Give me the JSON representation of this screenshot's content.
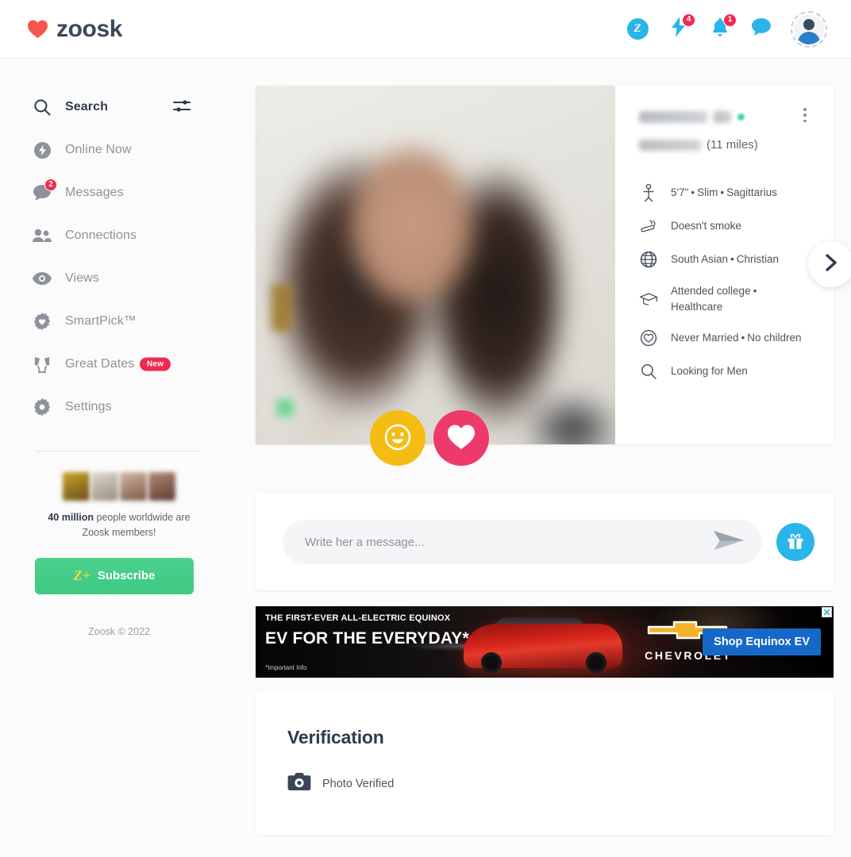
{
  "header": {
    "brand": "zoosk",
    "brand_icon": "heart-icon",
    "icons": {
      "zoosk_coins": "Z",
      "boost_icon": "lightning-bolt-icon",
      "boost_badge": "4",
      "bell_icon": "bell-icon",
      "bell_badge": "1",
      "chat_icon": "chat-bubble-icon",
      "avatar": "user-avatar-icon"
    }
  },
  "sidebar": {
    "items": [
      {
        "label": "Search",
        "icon": "search-icon",
        "active": true,
        "badge": null,
        "pill": null
      },
      {
        "label": "Online Now",
        "icon": "bolt-circle-icon",
        "active": false,
        "badge": null,
        "pill": null
      },
      {
        "label": "Messages",
        "icon": "chat-bubble-icon",
        "active": false,
        "badge": "2",
        "pill": null
      },
      {
        "label": "Connections",
        "icon": "people-icon",
        "active": false,
        "badge": null,
        "pill": null
      },
      {
        "label": "Views",
        "icon": "eye-icon",
        "active": false,
        "badge": null,
        "pill": null
      },
      {
        "label": "SmartPick™",
        "icon": "gear-heart-icon",
        "active": false,
        "badge": null,
        "pill": null
      },
      {
        "label": "Great Dates",
        "icon": "cheers-icon",
        "active": false,
        "badge": null,
        "pill": "New"
      },
      {
        "label": "Settings",
        "icon": "gear-icon",
        "active": false,
        "badge": null,
        "pill": null
      }
    ],
    "filter_icon": "sliders-filter-icon",
    "promo": {
      "bold": "40 million",
      "rest": " people worldwide are Zoosk members!",
      "subscribe_label": "Subscribe",
      "subscribe_icon": "z-plus-icon"
    },
    "copyright": "Zoosk © 2022"
  },
  "profile": {
    "name_redacted": true,
    "age_redacted": true,
    "online": true,
    "location_redacted": true,
    "distance": "(11 miles)",
    "menu_icon": "kebab-menu-icon",
    "next_icon": "chevron-right-icon",
    "actions": [
      {
        "name": "smile-button",
        "icon": "smiley-face-icon",
        "color": "#f5bc12"
      },
      {
        "name": "like-button",
        "icon": "heart-icon",
        "color": "#ee3a6b"
      }
    ],
    "details": [
      {
        "icon": "height-person-icon",
        "parts": [
          "5'7\"",
          "Slim",
          "Sagittarius"
        ]
      },
      {
        "icon": "no-smoking-icon",
        "parts": [
          "Doesn't smoke"
        ]
      },
      {
        "icon": "globe-icon",
        "parts": [
          "South Asian",
          "Christian"
        ]
      },
      {
        "icon": "graduation-cap-icon",
        "parts": [
          "Attended college",
          "Healthcare"
        ]
      },
      {
        "icon": "heart-circle-icon",
        "parts": [
          "Never Married",
          "No children"
        ]
      },
      {
        "icon": "search-icon",
        "parts": [
          "Looking for Men"
        ]
      }
    ]
  },
  "composer": {
    "placeholder": "Write her a message...",
    "value": "",
    "send_icon": "send-arrow-icon",
    "gift_icon": "gift-box-icon"
  },
  "ad": {
    "kicker": "THE FIRST-EVER ALL-ELECTRIC EQUINOX",
    "headline": "EV FOR THE EVERYDAY*",
    "fineprint": "*Important Info",
    "brand": "CHEVROLET",
    "cta": "Shop Equinox EV",
    "close_icon": "close-x-icon",
    "cta_color": "#1668c8"
  },
  "verification": {
    "title": "Verification",
    "items": [
      {
        "icon": "camera-icon",
        "label": "Photo Verified"
      }
    ]
  },
  "colors": {
    "accent_blue": "#2ab5ea",
    "badge_red": "#f2294f",
    "green": "#3ec982",
    "pink": "#ee3a6b",
    "yellow": "#f5bc12"
  }
}
